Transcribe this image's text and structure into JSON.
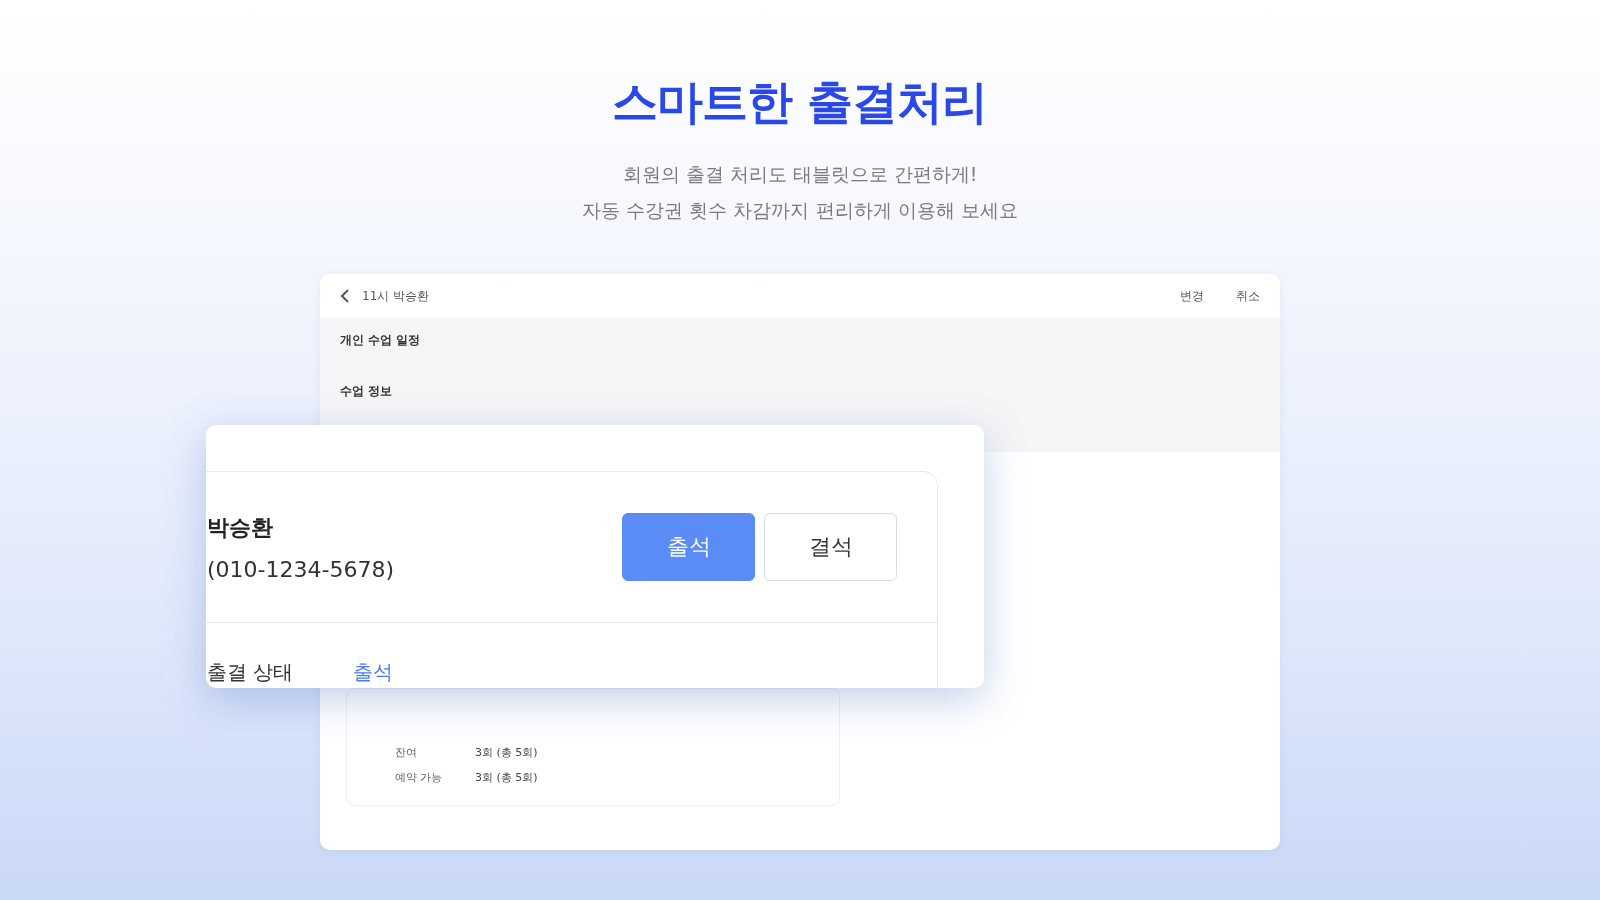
{
  "heading": {
    "title": "스마트한 출결처리",
    "subtitle": [
      "회원의 출결 처리도 태블릿으로 간편하게!",
      "자동 수강권 횟수 차감까지 편리하게 이용해 보세요"
    ]
  },
  "back_screen": {
    "title": "11시 박승환",
    "actions": [
      "변경",
      "취소"
    ],
    "section_title": "개인 수업 일정",
    "info_title": "수업 정보",
    "rows": [
      {
        "label": "잔여",
        "value": "3회 (총 5회)"
      },
      {
        "label": "예약 가능",
        "value": "3회 (총 5회)"
      }
    ]
  },
  "attendance_dialog": {
    "member_name": "박승환",
    "member_phone": "(010-1234-5678)",
    "options": [
      {
        "label": "출석",
        "selected": true
      },
      {
        "label": "결석",
        "selected": false
      }
    ],
    "status_label": "출결 상태",
    "status_value": "출석"
  }
}
